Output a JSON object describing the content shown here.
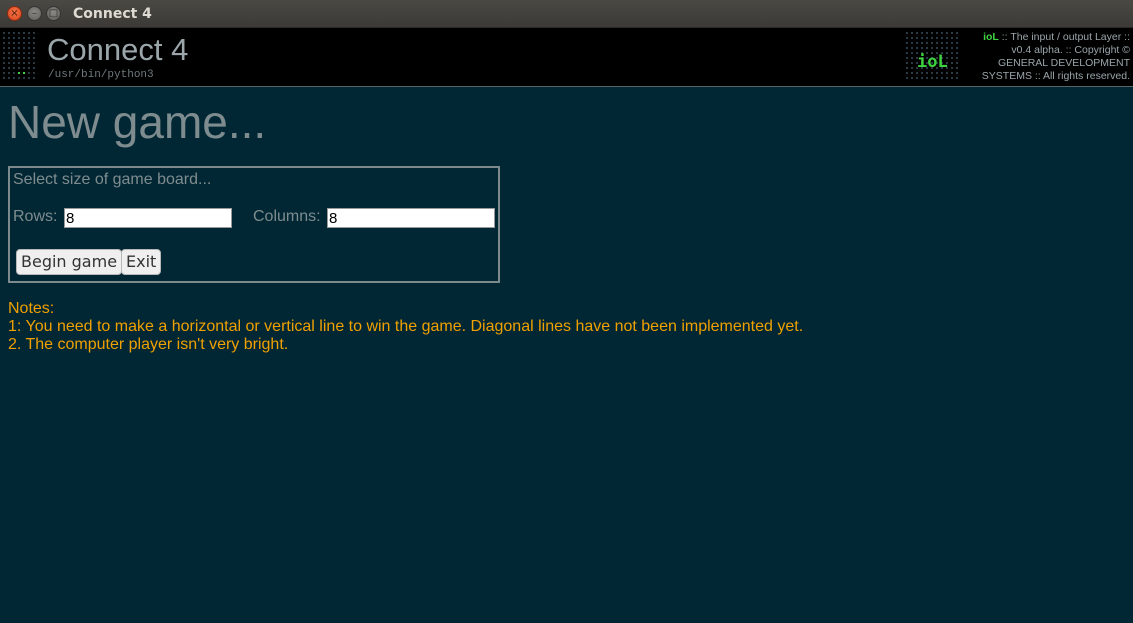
{
  "window": {
    "title": "Connect 4",
    "close_glyph": "×",
    "minimize_glyph": "–",
    "maximize_glyph": "□"
  },
  "header": {
    "app_title": "Connect 4",
    "app_path": "/usr/bin/python3",
    "logo_text": "ioL",
    "info_brand": "ioL",
    "info_line1": ":: The input / output Layer ::",
    "info_line2": "v0.4 alpha. :: Copyright ©",
    "info_line3": "GENERAL DEVELOPMENT",
    "info_line4": "SYSTEMS :: All rights reserved."
  },
  "main": {
    "heading": "New game...",
    "board_form": {
      "legend": "Select size of game board...",
      "rows_label": "Rows:",
      "rows_value": "8",
      "columns_label": "Columns:",
      "columns_value": "8",
      "begin_button": "Begin game",
      "exit_button": "Exit"
    },
    "notes": {
      "title": "Notes:",
      "line1": "1: You need to make a horizontal or vertical line to win the game. Diagonal lines have not been implemented yet.",
      "line2": "2. The computer player isn't very bright."
    }
  },
  "colors": {
    "background": "#002733",
    "header_bg": "#000000",
    "heading_text": "#7f8c8f",
    "notes_text": "#f0a000",
    "brand_green": "#3fd23f"
  }
}
